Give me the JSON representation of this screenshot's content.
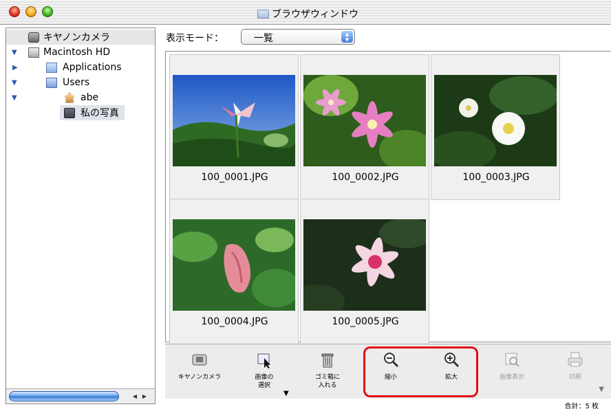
{
  "window": {
    "title": "ブラウザウィンドウ"
  },
  "sidebar": {
    "items": [
      {
        "label": "キヤノンカメラ",
        "icon": "camera-icon"
      },
      {
        "label": "Macintosh HD",
        "icon": "hard-disk-icon",
        "expanded": true
      },
      {
        "label": "Applications",
        "icon": "applications-folder-icon",
        "expanded": false
      },
      {
        "label": "Users",
        "icon": "users-folder-icon",
        "expanded": true
      },
      {
        "label": "abe",
        "icon": "home-icon",
        "expanded": true
      },
      {
        "label": "私の写真",
        "icon": "folder-icon",
        "selected": true
      }
    ]
  },
  "view": {
    "mode_label": "表示モード：",
    "mode_value": "一覧"
  },
  "thumbnails": [
    {
      "filename": "100_0001.JPG"
    },
    {
      "filename": "100_0002.JPG"
    },
    {
      "filename": "100_0003.JPG"
    },
    {
      "filename": "100_0004.JPG"
    },
    {
      "filename": "100_0005.JPG"
    }
  ],
  "toolbar": {
    "camera": "キヤノンカメラ",
    "select": "画像の\n選択",
    "trash": "ゴミ箱に\n入れる",
    "zoom_out": "縮小",
    "zoom_in": "拡大",
    "view_image": "画像表示",
    "print": "印刷"
  },
  "status": {
    "total": "合計：5 枚"
  },
  "colors": {
    "highlight": "#e40d14",
    "selection": "#dfe3ea"
  }
}
